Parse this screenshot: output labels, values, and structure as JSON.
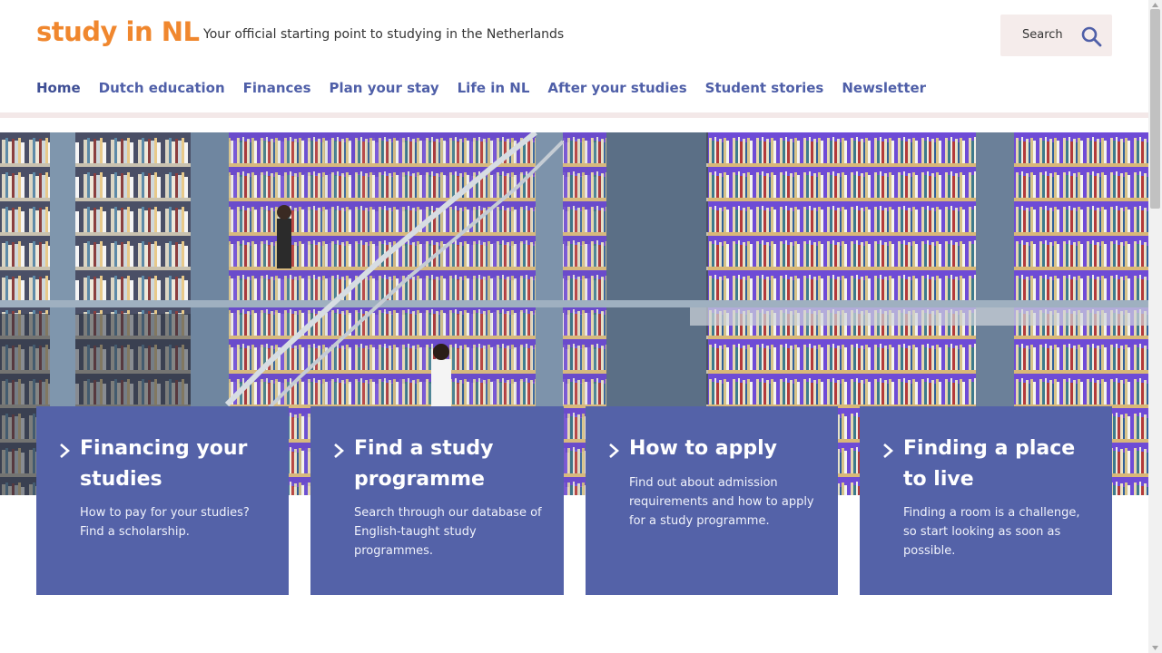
{
  "header": {
    "logo": "study in NL",
    "tagline": "Your official starting point to studying in the Netherlands",
    "search_label": "Search",
    "search_icon": "search-icon"
  },
  "nav": {
    "items": [
      {
        "label": "Home",
        "active": true
      },
      {
        "label": "Dutch education"
      },
      {
        "label": "Finances"
      },
      {
        "label": "Plan your stay"
      },
      {
        "label": "Life in NL"
      },
      {
        "label": "After your studies"
      },
      {
        "label": "Student stories"
      },
      {
        "label": "Newsletter"
      }
    ]
  },
  "cards": [
    {
      "title": "Financing your studies",
      "description": "How to pay for your studies? Find a scholarship."
    },
    {
      "title": "Find a study programme",
      "description": "Search through our database of English-taught study programmes."
    },
    {
      "title": "How to apply",
      "description": "Find out about admission requirements and how to apply for a study programme."
    },
    {
      "title": "Finding a place to live",
      "description": "Finding a room is a challenge, so start looking as soon as possible."
    }
  ],
  "colors": {
    "brand_orange": "#f0872e",
    "nav_blue": "#4f5fa8",
    "card_blue": "#5462a8",
    "search_bg": "#f5eceb"
  }
}
